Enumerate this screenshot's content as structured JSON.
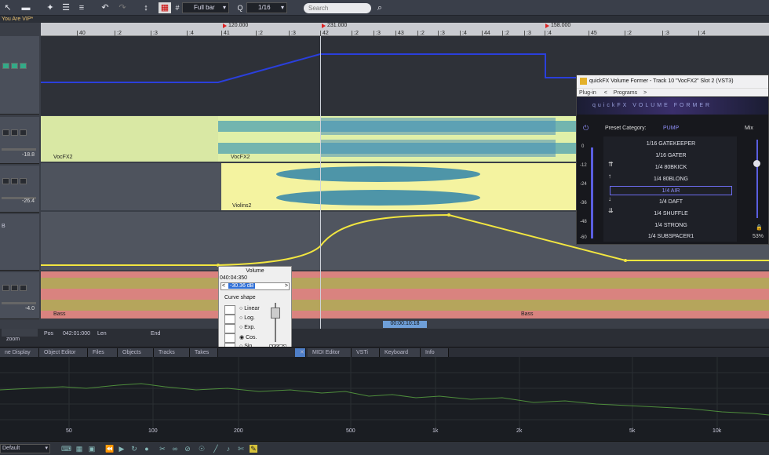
{
  "toolbar": {
    "snap_mode": "Full bar",
    "quantize_icon": "Q",
    "quantize": "1/16",
    "search_placeholder": "Search",
    "grid_icon": "#",
    "icons": [
      "pointer-tool-icon",
      "crossfade-tool-icon",
      "snap-icon",
      "list-icon",
      "undo-icon",
      "redo-icon",
      "cursor-icon",
      "grid-icon",
      "search-icon"
    ]
  },
  "window_title": "You Are VIP*",
  "ruler": {
    "ticks": [
      "40",
      ":2",
      ":3",
      ":4",
      "41",
      ":2",
      ":3",
      "42",
      ":2",
      ":3",
      "43",
      ":2",
      ":3",
      ":4",
      "44",
      ":2",
      ":3",
      ":4",
      "45",
      ":2",
      ":3",
      ":4"
    ],
    "markers": [
      "120.000",
      "231.000",
      "158.000"
    ]
  },
  "tracks": {
    "vocfx_label": "VocFX2",
    "vocfx_label2": "VocFX2",
    "vocfx_db": "-18.8",
    "violins_label": "Violins2",
    "violins_db": "-26.4",
    "bass_label": "Bass",
    "bass_label2": "Bass",
    "bass_db": "-4.0",
    "auto_label": "B"
  },
  "plugin": {
    "title": "quickFX Volume Former - Track 10  \"VocFX2\" Slot 2 (VST3)",
    "menu_plugin": "Plug-in",
    "menu_programs": "Programs",
    "banner": "quickFX  VOLUME  FORMER",
    "preset_category_label": "Preset Category:",
    "preset_category_value": "PUMP",
    "mix_label": "Mix",
    "mix_value": "53%",
    "scale": [
      "0",
      "-12",
      "-24",
      "-36",
      "-48",
      "-60"
    ],
    "presets": [
      "1/16 GATEKEEPER",
      "1/16 GATER",
      "1/4 80BKICK",
      "1/4 80BLONG",
      "1/4 AIR",
      "1/4 DAFT",
      "1/4 SHUFFLE",
      "1/4 STRONG",
      "1/4 SUBSPACER1"
    ],
    "selected_preset": "1/4 AIR"
  },
  "volume_popup": {
    "title": "Volume",
    "time": "040:04:350",
    "value": "-30.36 dB",
    "curve_shape_label": "Curve shape",
    "options": [
      "Linear",
      "Log.",
      "Exp.",
      "Cos.",
      "Sin."
    ],
    "selected": "Cos.",
    "numeric": "166.0"
  },
  "transport": {
    "zoom_label": "zoom",
    "pos_label": "Pos",
    "pos_value": "042:01:000",
    "len_label": "Len",
    "end_label": "End",
    "length_display": "00:00:10:18"
  },
  "bottom_tabs": [
    "ne Display",
    "Object Editor",
    "Files",
    "Objects",
    "Tracks",
    "Takes",
    "MIDI Editor",
    "VSTi",
    "Keyboard",
    "Info"
  ],
  "spectrum": {
    "freq_labels": [
      "50",
      "100",
      "200",
      "500",
      "1k",
      "2k",
      "5k",
      "10k"
    ]
  },
  "status": {
    "preset": "Default"
  },
  "colors": {
    "vocal_clip": "#e0f0a8",
    "violin_clip": "#f4f3a0",
    "bass_clip": "#e58a86",
    "automation": "#f2e640",
    "volume_line": "#2a3fdc",
    "spectrum": "#4e8d3c"
  }
}
